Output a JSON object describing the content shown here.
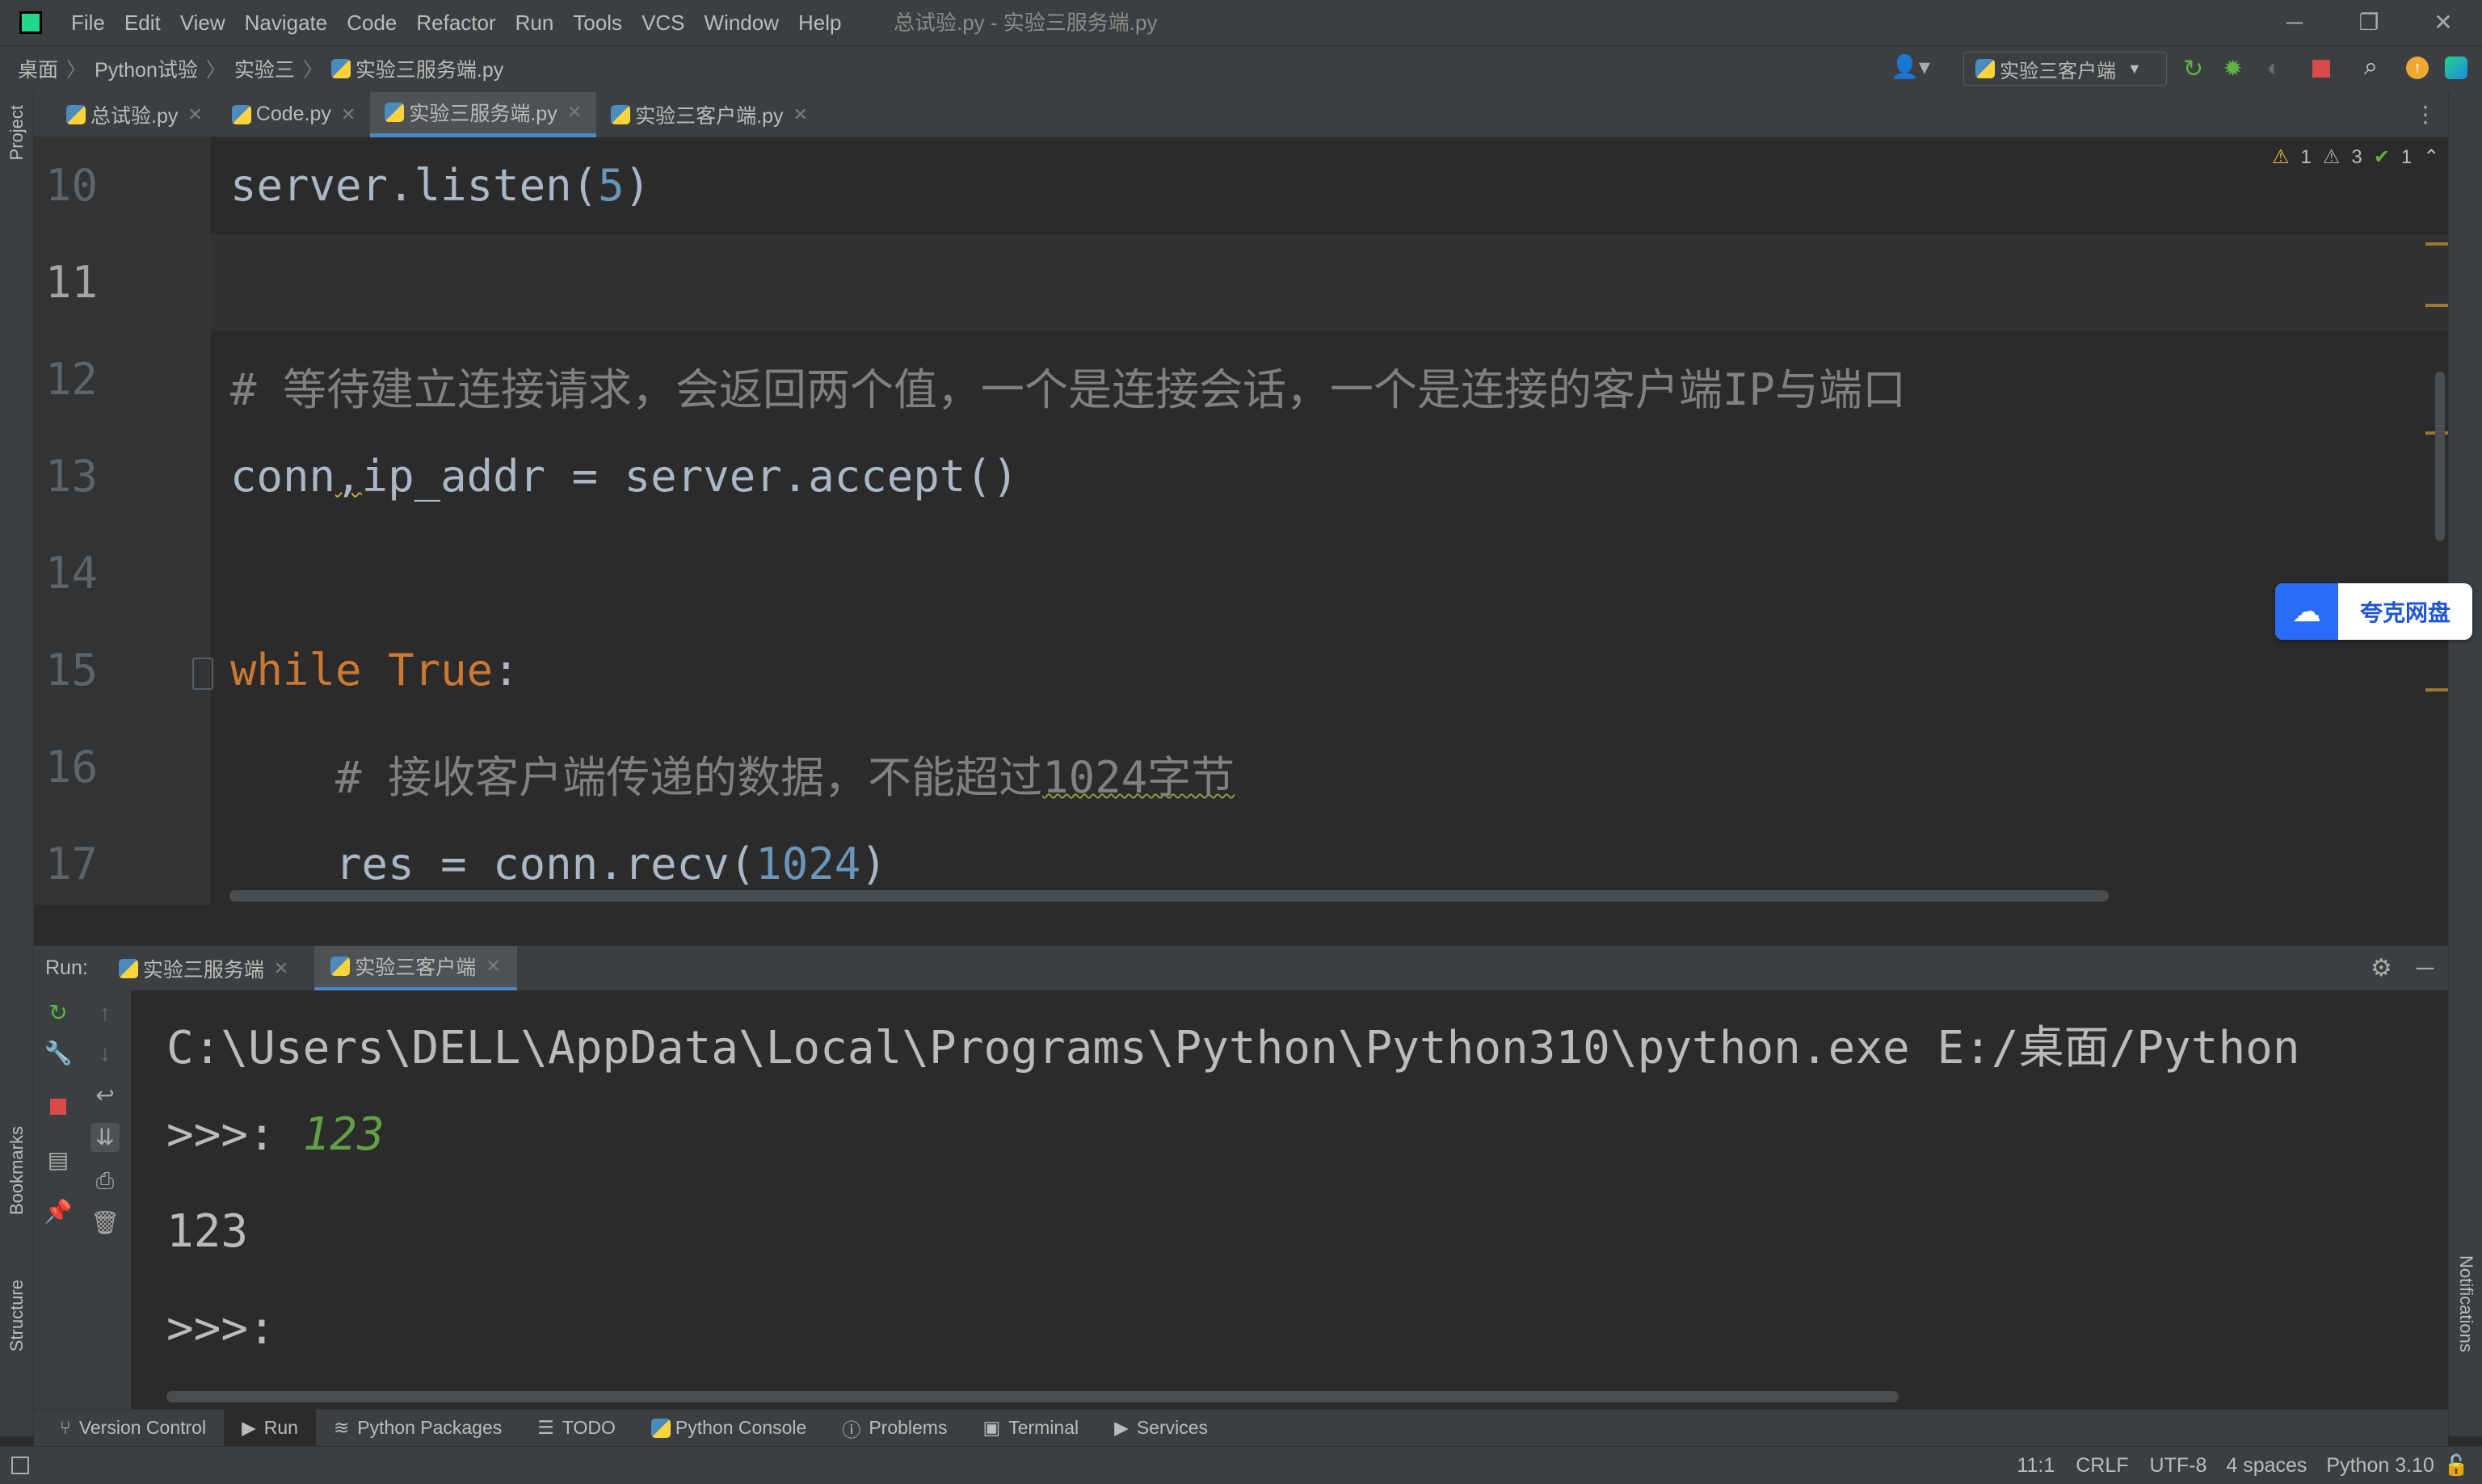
{
  "window": {
    "title": "总试验.py - 实验三服务端.py",
    "menu": [
      "File",
      "Edit",
      "View",
      "Navigate",
      "Code",
      "Refactor",
      "Run",
      "Tools",
      "VCS",
      "Window",
      "Help"
    ]
  },
  "breadcrumb": [
    "桌面",
    "Python试验",
    "实验三",
    "实验三服务端.py"
  ],
  "run_config": "实验三客户端",
  "side_tools": {
    "project": "Project",
    "bookmarks": "Bookmarks",
    "structure": "Structure",
    "notifications": "Notifications"
  },
  "tabs": [
    {
      "label": "总试验.py",
      "active": false
    },
    {
      "label": "Code.py",
      "active": false
    },
    {
      "label": "实验三服务端.py",
      "active": true
    },
    {
      "label": "实验三客户端.py",
      "active": false
    }
  ],
  "inspections": {
    "warnings": "1",
    "weak_warnings": "3",
    "typos": "1"
  },
  "editor": {
    "lines": [
      {
        "n": "10"
      },
      {
        "n": "11"
      },
      {
        "n": "12"
      },
      {
        "n": "13"
      },
      {
        "n": "14"
      },
      {
        "n": "15"
      },
      {
        "n": "16"
      },
      {
        "n": "17"
      }
    ],
    "code": {
      "l10_a": "server.listen(",
      "l10_num": "5",
      "l10_b": ")",
      "l12": "# 等待建立连接请求，会返回两个值，一个是连接会话，一个是连接的客户端IP与端口",
      "l13_a": "conn",
      "l13_comma": ",",
      "l13_b": "ip_addr = server.accept()",
      "l15_kw1": "while",
      "l15_kw2": "True",
      "l15_b": ":",
      "l16_a": "    # 接收客户端传递的数据，不能超过",
      "l16_b": "1024字节",
      "l17_a": "    res = conn.recv(",
      "l17_num": "1024",
      "l17_b": ")"
    }
  },
  "quark": {
    "label": "夸克网盘"
  },
  "run_panel": {
    "label": "Run:",
    "tabs": [
      {
        "label": "实验三服务端",
        "active": false
      },
      {
        "label": "实验三客户端",
        "active": true
      }
    ],
    "console": {
      "cmd": "C:\\Users\\DELL\\AppData\\Local\\Programs\\Python\\Python310\\python.exe E:/桌面/Python",
      "prompt1": ">>>: ",
      "input1": "123",
      "output1": "123",
      "prompt2": ">>>:"
    }
  },
  "bottom_tabs": [
    {
      "label": "Version Control",
      "icon": "branch-icon"
    },
    {
      "label": "Run",
      "icon": "play-icon"
    },
    {
      "label": "Python Packages",
      "icon": "layers-icon"
    },
    {
      "label": "TODO",
      "icon": "list-icon"
    },
    {
      "label": "Python Console",
      "icon": "python-icon"
    },
    {
      "label": "Problems",
      "icon": "info-icon"
    },
    {
      "label": "Terminal",
      "icon": "terminal-icon"
    },
    {
      "label": "Services",
      "icon": "services-icon"
    }
  ],
  "status": {
    "position": "11:1",
    "line_sep": "CRLF",
    "encoding": "UTF-8",
    "indent": "4 spaces",
    "interpreter": "Python 3.10"
  }
}
